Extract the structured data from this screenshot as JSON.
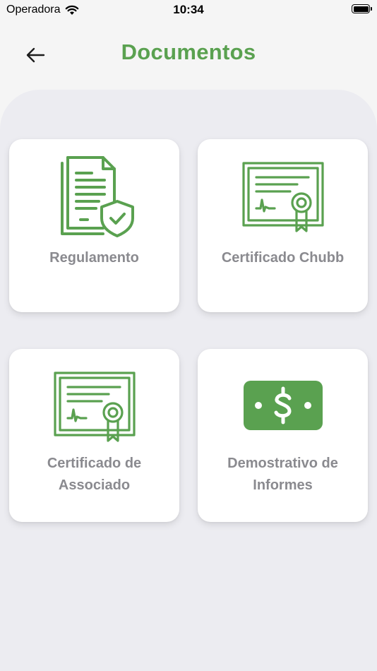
{
  "status_bar": {
    "carrier": "Operadora",
    "time": "10:34"
  },
  "header": {
    "title": "Documentos"
  },
  "colors": {
    "accent": "#5aa150",
    "label": "#8a8a8f",
    "background": "#ececf1"
  },
  "cards": [
    {
      "label": "Regulamento",
      "icon": "document-shield-icon"
    },
    {
      "label": "Certificado Chubb",
      "icon": "certificate-icon"
    },
    {
      "label_line1": "Certificado de",
      "label_line2": "Associado",
      "icon": "certificate-icon"
    },
    {
      "label_line1": "Demostrativo de",
      "label_line2": "Informes",
      "icon": "money-icon"
    }
  ]
}
